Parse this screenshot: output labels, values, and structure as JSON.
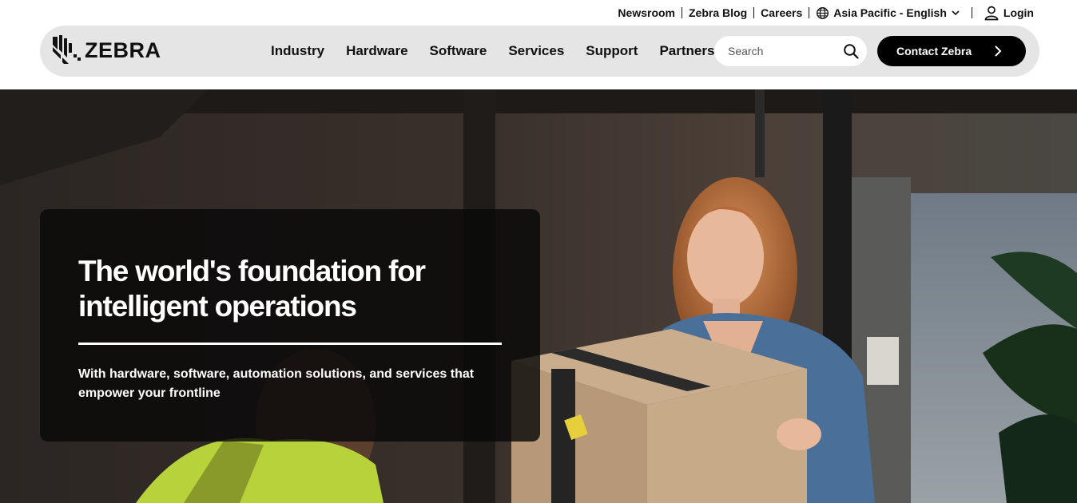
{
  "utility": {
    "links": [
      "Newsroom",
      "Zebra Blog",
      "Careers"
    ],
    "region": "Asia Pacific - English",
    "login": "Login"
  },
  "nav": {
    "logo_text": "ZEBRA",
    "items": [
      "Industry",
      "Hardware",
      "Software",
      "Services",
      "Support",
      "Partners"
    ],
    "search_placeholder": "Search",
    "contact_label": "Contact Zebra"
  },
  "hero": {
    "title": "The world's foundation for intelligent operations",
    "subtitle": "With hardware, software, automation solutions, and services that empower your frontline"
  },
  "colors": {
    "nav_bg": "#e5e5e5",
    "contact_bg": "#000000",
    "card_bg": "#080808"
  }
}
